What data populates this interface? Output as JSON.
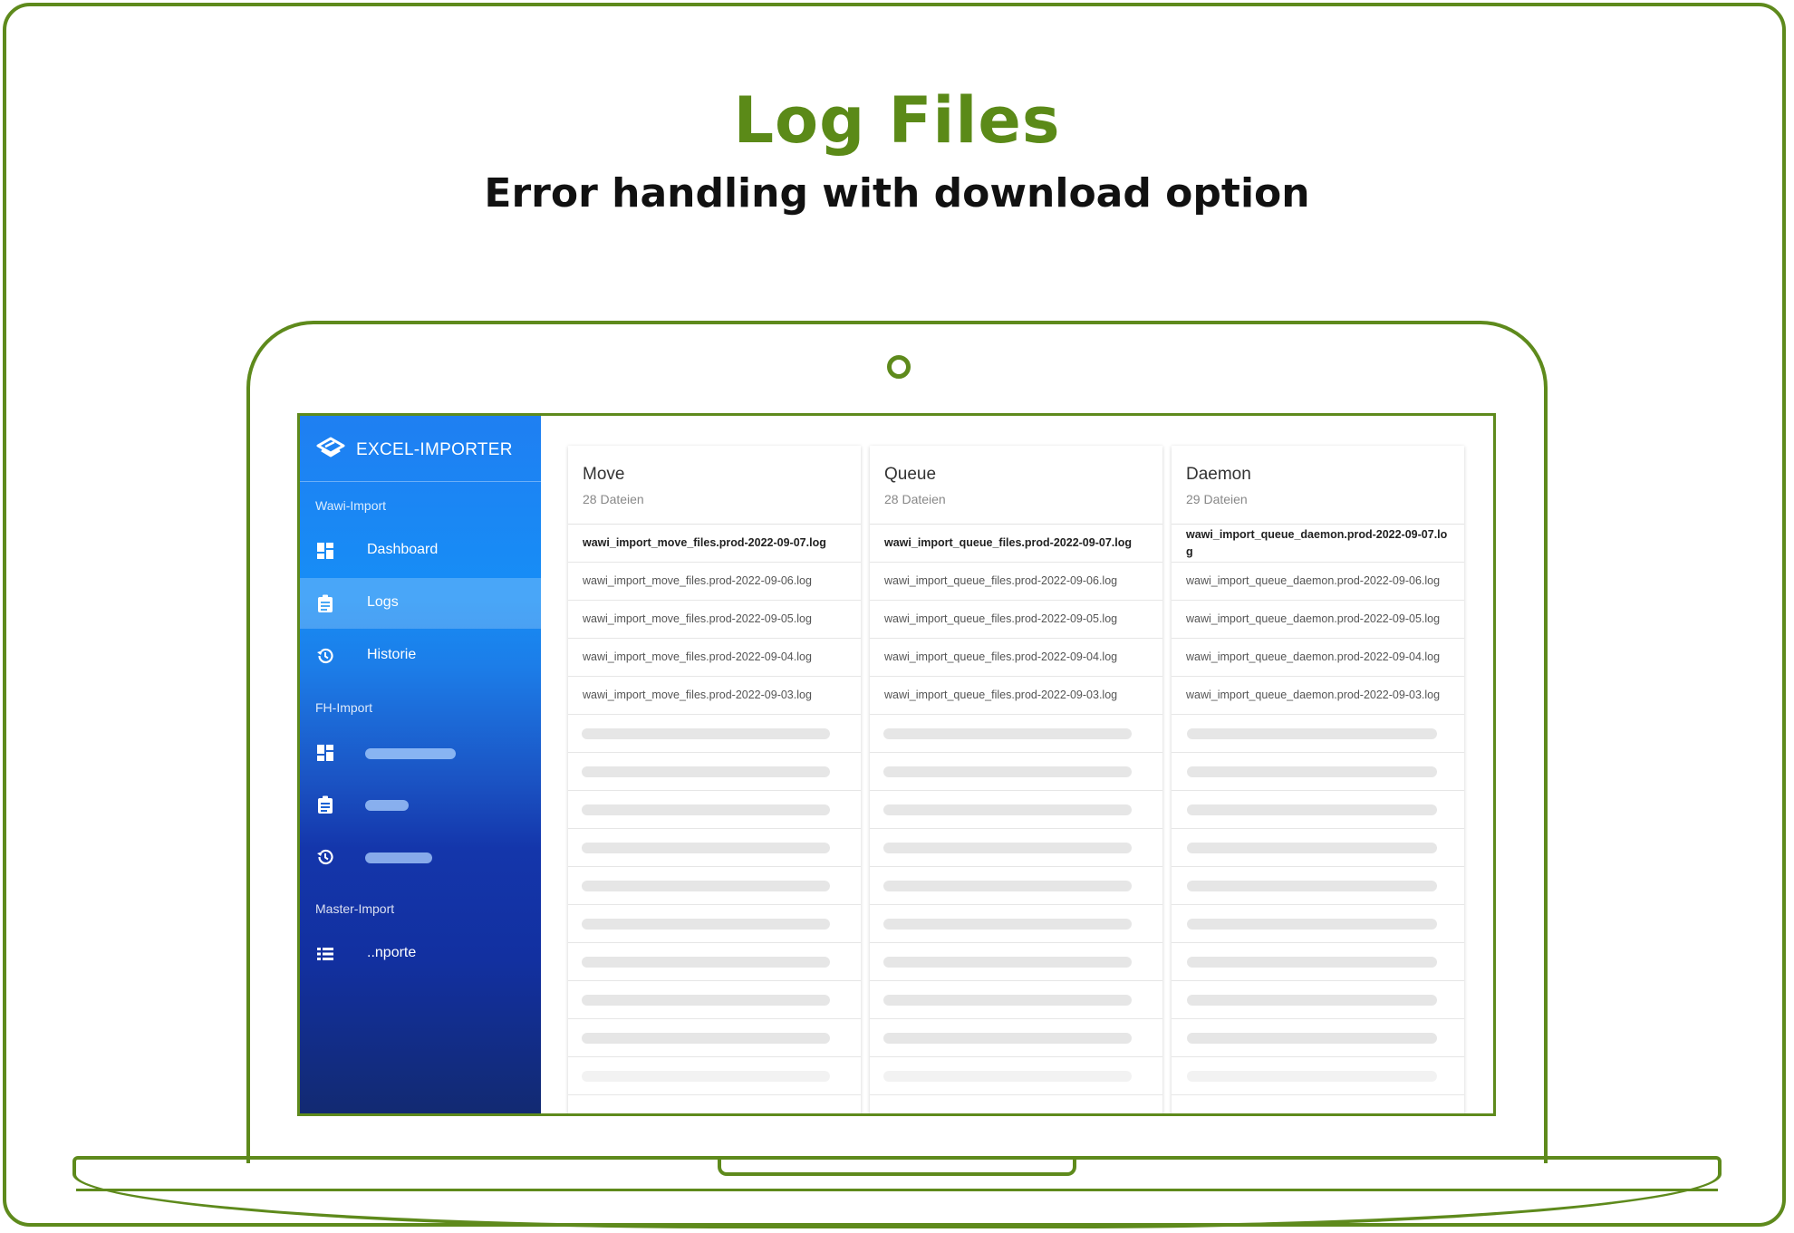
{
  "hero": {
    "title": "Log Files",
    "subtitle": "Error handling with download option"
  },
  "colors": {
    "frame_green": "#5e8a1c",
    "sidebar_blue": "#168ef6",
    "sidebar_dark": "#122a72"
  },
  "app": {
    "brand_name": "EXCEL-IMPORTER",
    "brand_icon": "layers-icon"
  },
  "sidebar": {
    "sections": [
      {
        "label": "Wawi-Import",
        "items": [
          {
            "label": "Dashboard",
            "icon": "dashboard-icon",
            "active": false
          },
          {
            "label": "Logs",
            "icon": "clipboard-icon",
            "active": true
          },
          {
            "label": "Historie",
            "icon": "history-icon",
            "active": false
          }
        ]
      },
      {
        "label": "FH-Import",
        "items": [
          {
            "label": "",
            "icon": "dashboard-icon"
          },
          {
            "label": "",
            "icon": "clipboard-icon"
          },
          {
            "label": "",
            "icon": "history-icon"
          }
        ]
      },
      {
        "label": "Master-Import",
        "items": [
          {
            "label": "..nporte",
            "icon": "list-icon"
          }
        ]
      }
    ]
  },
  "cards": [
    {
      "title": "Move",
      "count": "28 Dateien",
      "files": [
        "wawi_import_move_files.prod-2022-09-07.log",
        "wawi_import_move_files.prod-2022-09-06.log",
        "wawi_import_move_files.prod-2022-09-05.log",
        "wawi_import_move_files.prod-2022-09-04.log",
        "wawi_import_move_files.prod-2022-09-03.log"
      ]
    },
    {
      "title": "Queue",
      "count": "28 Dateien",
      "files": [
        "wawi_import_queue_files.prod-2022-09-07.log",
        "wawi_import_queue_files.prod-2022-09-06.log",
        "wawi_import_queue_files.prod-2022-09-05.log",
        "wawi_import_queue_files.prod-2022-09-04.log",
        "wawi_import_queue_files.prod-2022-09-03.log"
      ]
    },
    {
      "title": "Daemon",
      "count": "29 Dateien",
      "files": [
        "wawi_import_queue_daemon.prod-2022-09-07.log",
        "wawi_import_queue_daemon.prod-2022-09-06.log",
        "wawi_import_queue_daemon.prod-2022-09-05.log",
        "wawi_import_queue_daemon.prod-2022-09-04.log",
        "wawi_import_queue_daemon.prod-2022-09-03.log"
      ]
    }
  ]
}
